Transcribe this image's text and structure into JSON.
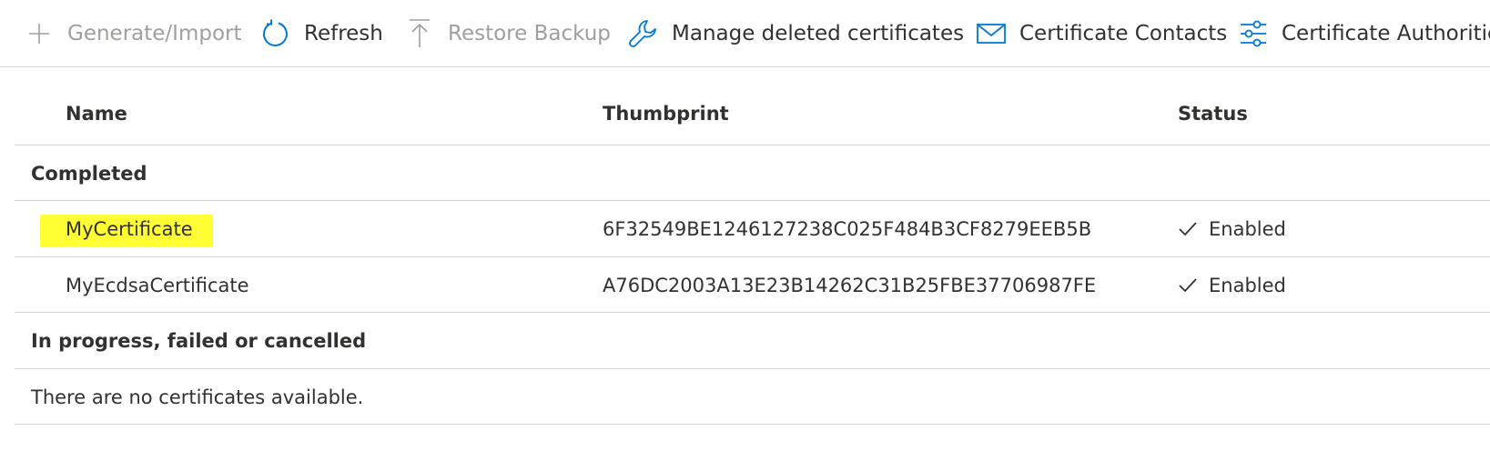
{
  "toolbar": {
    "generate_import": "Generate/Import",
    "refresh": "Refresh",
    "restore_backup": "Restore Backup",
    "manage_deleted": "Manage deleted certificates",
    "certificate_contacts": "Certificate Contacts",
    "certificate_authorities": "Certificate Authorities"
  },
  "table": {
    "columns": {
      "name": "Name",
      "thumbprint": "Thumbprint",
      "status": "Status"
    },
    "groups": [
      {
        "label": "Completed",
        "rows": [
          {
            "name": "MyCertificate",
            "thumbprint": "6F32549BE1246127238C025F484B3CF8279EEB5B",
            "status": "Enabled",
            "highlighted": true
          },
          {
            "name": "MyEcdsaCertificate",
            "thumbprint": "A76DC2003A13E23B14262C31B25FBE37706987FE",
            "status": "Enabled",
            "highlighted": false
          }
        ]
      },
      {
        "label": "In progress, failed or cancelled",
        "empty_message": "There are no certificates available."
      }
    ]
  },
  "colors": {
    "accent": "#0078d4",
    "highlight": "#ffff33",
    "disabled_text": "#a19f9d",
    "text": "#323130",
    "divider": "#d6d6d6"
  },
  "icons": {
    "generate_import": "plus-icon",
    "refresh": "refresh-icon",
    "restore_backup": "upload-arrow-icon",
    "manage_deleted": "wrench-icon",
    "certificate_contacts": "mail-icon",
    "certificate_authorities": "sliders-icon",
    "status": "checkmark-icon"
  }
}
